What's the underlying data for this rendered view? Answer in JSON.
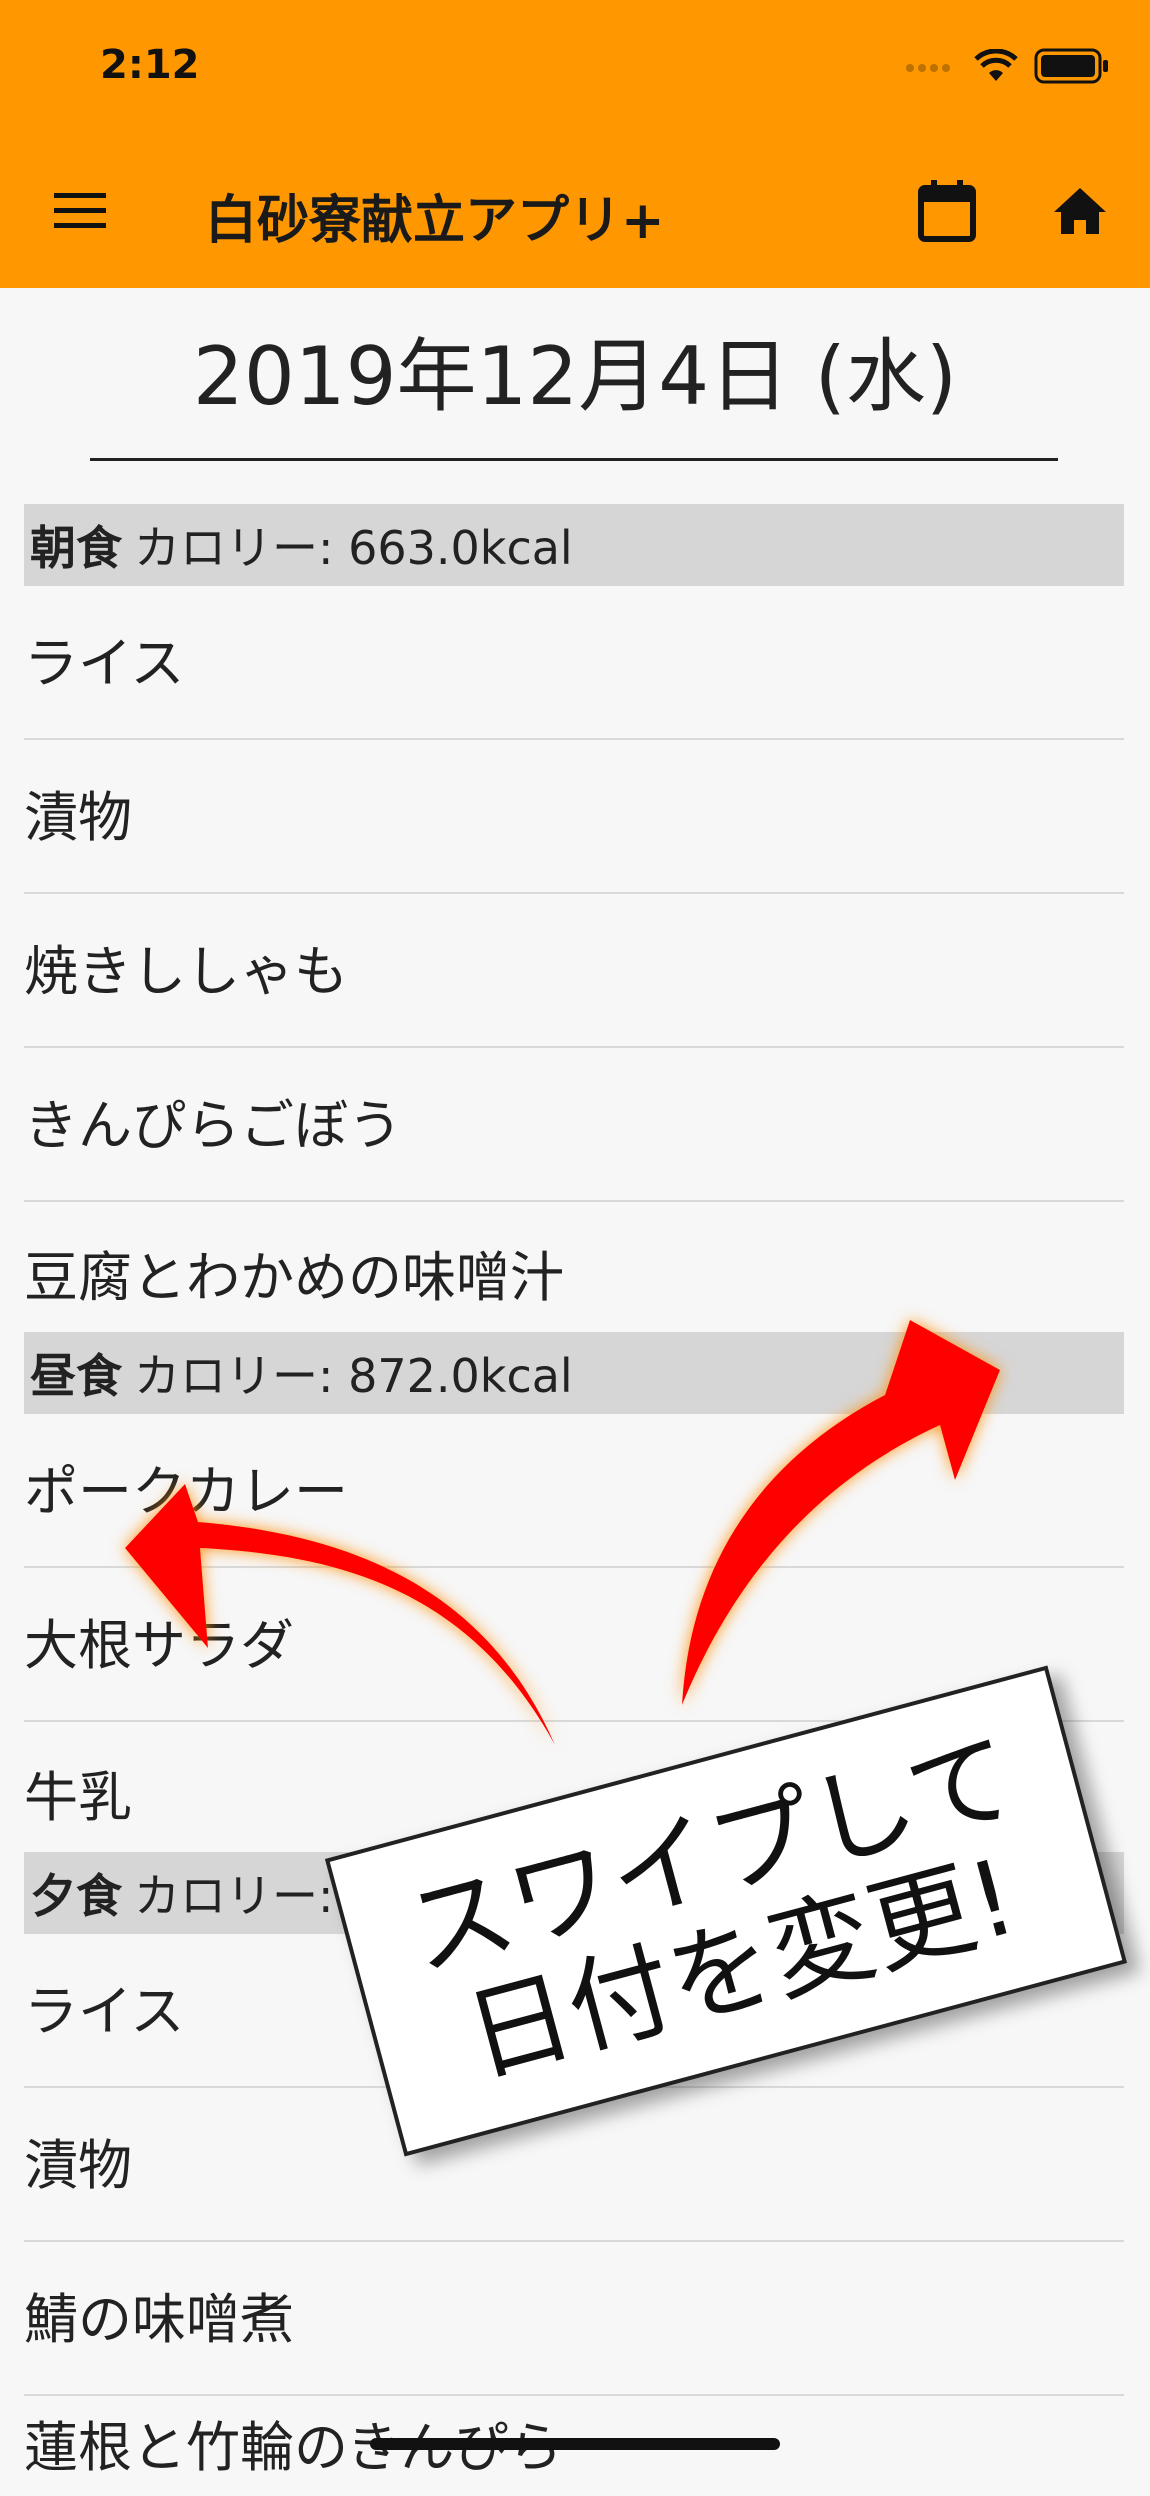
{
  "status_bar": {
    "time": "2:12"
  },
  "app_bar": {
    "title": "白砂寮献立アプリ+"
  },
  "date": "2019年12月4日 (水)",
  "meals": [
    {
      "name": "朝食",
      "calories": "カロリー: 663.0kcal",
      "dishes": [
        "ライス",
        "漬物",
        "焼きししゃも",
        "きんぴらごぼう",
        "豆腐とわかめの味噌汁"
      ]
    },
    {
      "name": "昼食",
      "calories": "カロリー: 872.0kcal",
      "dishes": [
        "ポークカレー",
        "大根サラダ",
        "牛乳"
      ]
    },
    {
      "name": "夕食",
      "calories": "カロリー: 745.0kcal",
      "dishes": [
        "ライス",
        "漬物",
        "鯖の味噌煮",
        "蓮根と竹輪のきんぴら"
      ]
    }
  ],
  "overlay": {
    "line1": "スワイプして",
    "line2": "日付を変更!"
  },
  "colors": {
    "app_bar": "#ff9800",
    "arrow": "#ff0000",
    "meal_header_bg": "#d6d6d6"
  },
  "icons": [
    "menu-icon",
    "calendar-icon",
    "home-icon",
    "signal-icon",
    "wifi-icon",
    "battery-icon"
  ]
}
